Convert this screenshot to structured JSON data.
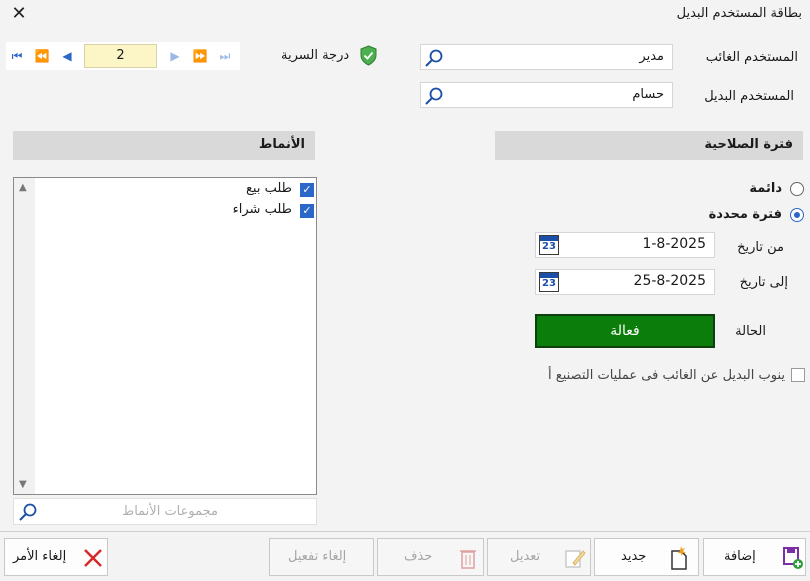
{
  "window": {
    "title": "بطاقة المستخدم البديل"
  },
  "fields": {
    "absent_user_label": "المستخدم الغائب",
    "absent_user_value": "مدير",
    "substitute_user_label": "المستخدم البديل",
    "substitute_user_value": "حسام",
    "confidentiality_label": "درجة السرية"
  },
  "pager": {
    "current": "2"
  },
  "validity": {
    "header": "فترة الصلاحية",
    "permanent_label": "دائمة",
    "specific_label": "فترة محددة",
    "selected": "specific",
    "from_label": "من تاريخ",
    "from_value": "1-8-2025",
    "to_label": "إلى تاريخ",
    "to_value": "25-8-2025",
    "status_label": "الحالة",
    "status_value": "فعالة",
    "status_color": "#0a7d0a",
    "manufacturing_label": "ينوب البديل عن الغائب فى عمليات التصنيع أ",
    "manufacturing_checked": false
  },
  "patterns": {
    "header": "الأنماط",
    "items": [
      {
        "label": "طلب بيع",
        "checked": true
      },
      {
        "label": "طلب شراء",
        "checked": true
      }
    ],
    "search_placeholder": "مجموعات الأنماط"
  },
  "toolbar": {
    "add": "إضافة",
    "new": "جديد",
    "edit": "تعديل",
    "delete": "حذف",
    "deactivate": "إلغاء تفعيل",
    "cancel": "إلغاء الأمر"
  },
  "icons": {
    "close": "close-icon",
    "search": "search-icon",
    "shield": "shield-icon",
    "calendar": "calendar-icon",
    "calendar_day": "23"
  }
}
